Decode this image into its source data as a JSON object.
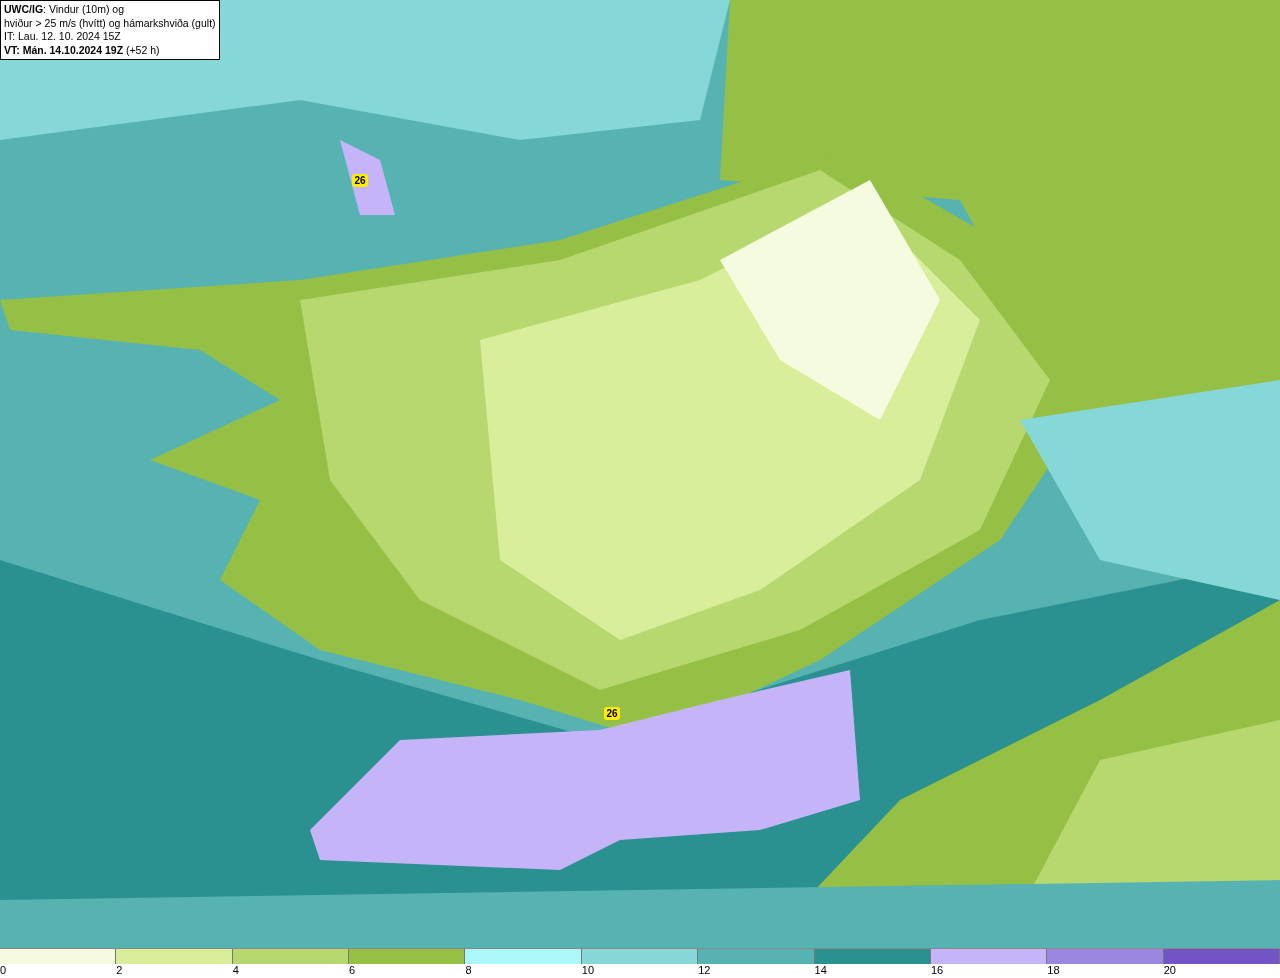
{
  "title_box": {
    "lines": [
      "**UWC/IG**: Vindur (10m) og",
      "hviður > 25 m/s (hvítt) og hámarkshviða (gult)",
      "IT: Lau. 12. 10. 2024 15Z",
      "**VT: Mán. 14.10.2024 19Z** (+52 h)"
    ]
  },
  "map": {
    "gust_badges": [
      {
        "label": "26"
      },
      {
        "label": "26"
      }
    ]
  },
  "legend": {
    "bins": [
      {
        "label": "0",
        "color": "#f5fbdf"
      },
      {
        "label": "2",
        "color": "#d8ee9a"
      },
      {
        "label": "4",
        "color": "#b6d86e"
      },
      {
        "label": "6",
        "color": "#95bf45"
      },
      {
        "label": "8",
        "color": "#aaf8fa"
      },
      {
        "label": "10",
        "color": "#86d8d8"
      },
      {
        "label": "12",
        "color": "#57b3b2"
      },
      {
        "label": "14",
        "color": "#2a9190"
      },
      {
        "label": "16",
        "color": "#c5b5f8"
      },
      {
        "label": "18",
        "color": "#9a86de"
      },
      {
        "label": "20",
        "color": "#7255c4"
      }
    ]
  }
}
